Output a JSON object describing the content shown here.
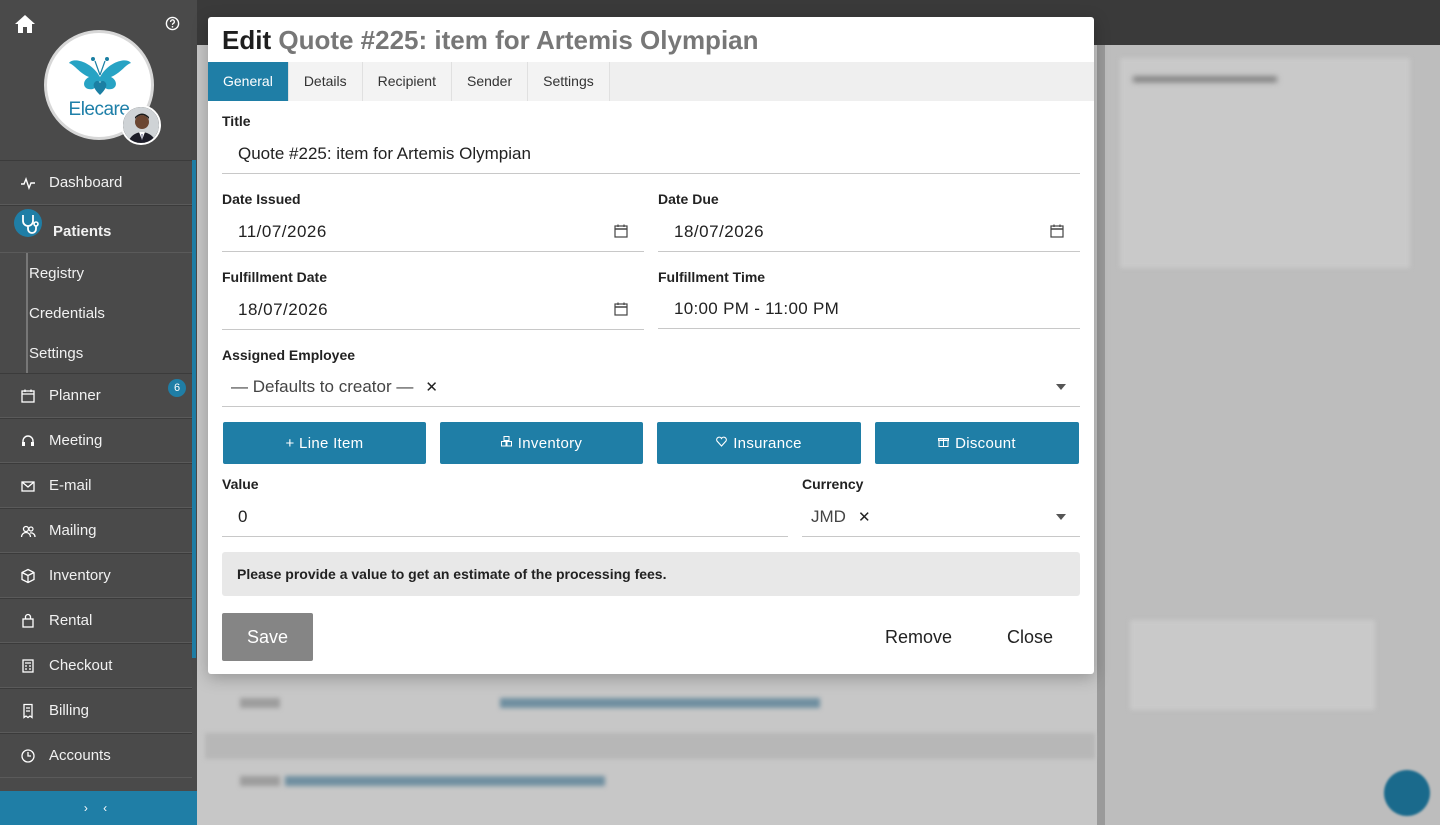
{
  "app": {
    "logo_text": "Elecare",
    "accent_color": "#1f7ea6"
  },
  "sidebar": {
    "items": [
      {
        "label": "Dashboard",
        "icon": "activity-icon"
      },
      {
        "label": "Patients",
        "icon": "stethoscope-icon"
      },
      {
        "label": "Registry"
      },
      {
        "label": "Credentials"
      },
      {
        "label": "Settings"
      },
      {
        "label": "Planner",
        "icon": "calendar-icon",
        "badge": "6"
      },
      {
        "label": "Meeting",
        "icon": "headset-icon"
      },
      {
        "label": "E-mail",
        "icon": "mail-icon"
      },
      {
        "label": "Mailing",
        "icon": "users-icon"
      },
      {
        "label": "Inventory",
        "icon": "box-icon"
      },
      {
        "label": "Rental",
        "icon": "bag-icon"
      },
      {
        "label": "Checkout",
        "icon": "register-icon"
      },
      {
        "label": "Billing",
        "icon": "receipt-icon"
      },
      {
        "label": "Accounts",
        "icon": "clock-icon"
      }
    ],
    "collapse_label": "› ‹"
  },
  "modal": {
    "title_prefix": "Edit",
    "title_quote": "Quote #225: item for Artemis Olympian",
    "tabs": [
      "General",
      "Details",
      "Recipient",
      "Sender",
      "Settings"
    ],
    "active_tab": "General",
    "fields": {
      "title_label": "Title",
      "title_value": "Quote #225: item for Artemis Olympian",
      "date_issued_label": "Date Issued",
      "date_issued_value": "11/07/2026",
      "date_due_label": "Date Due",
      "date_due_value": "18/07/2026",
      "fulfillment_date_label": "Fulfillment Date",
      "fulfillment_date_value": "18/07/2026",
      "fulfillment_time_label": "Fulfillment Time",
      "fulfillment_time_value": "10:00 PM - 11:00 PM",
      "assigned_employee_label": "Assigned Employee",
      "assigned_employee_value": "— Defaults to creator —",
      "value_label": "Value",
      "value_value": "0",
      "currency_label": "Currency",
      "currency_value": "JMD"
    },
    "buttons": {
      "line_item": "+ Line Item",
      "inventory": "Inventory",
      "insurance": "Insurance",
      "discount": "Discount",
      "save": "Save",
      "remove": "Remove",
      "close": "Close"
    },
    "fee_note": "Please provide a value to get an estimate of the processing fees."
  }
}
